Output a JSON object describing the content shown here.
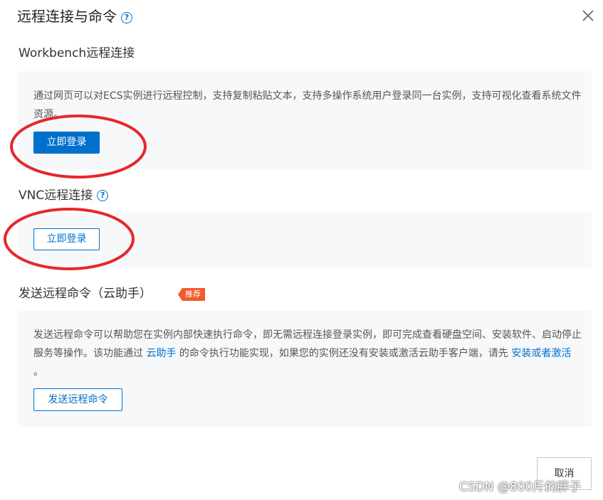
{
  "dialog": {
    "title": "远程连接与命令",
    "help_icon": "question-circle-icon",
    "close_icon": "close-icon"
  },
  "workbench": {
    "title": "Workbench远程连接",
    "desc": "通过网页可以对ECS实例进行远程控制，支持复制粘贴文本，支持多操作系统用户登录同一台实例，支持可视化查看系统文件资源。",
    "button": "立即登录"
  },
  "vnc": {
    "title": "VNC远程连接",
    "help_icon": "question-circle-icon",
    "button": "立即登录"
  },
  "command": {
    "title": "发送远程命令（云助手）",
    "badge": "推荐",
    "desc_1": "发送远程命令可以帮助您在实例内部快速执行命令，即无需远程连接登录实例，即可完成查看硬盘空间、安装软件、启动停止服务等操作。该功能通过",
    "link_1": "云助手",
    "desc_2": "的命令执行功能实现，如果您的实例还没有安装或激活云助手客户端，请先",
    "link_2": "安装或者激活",
    "desc_3": "。",
    "button": "发送远程命令"
  },
  "footer": {
    "cancel": "取消"
  },
  "watermark": "CSDN @800斤的胖子",
  "colors": {
    "accent": "#0070cc",
    "badge": "#ef5b2c",
    "annotation": "#e8262b",
    "panel_bg": "#f7f8fa"
  }
}
